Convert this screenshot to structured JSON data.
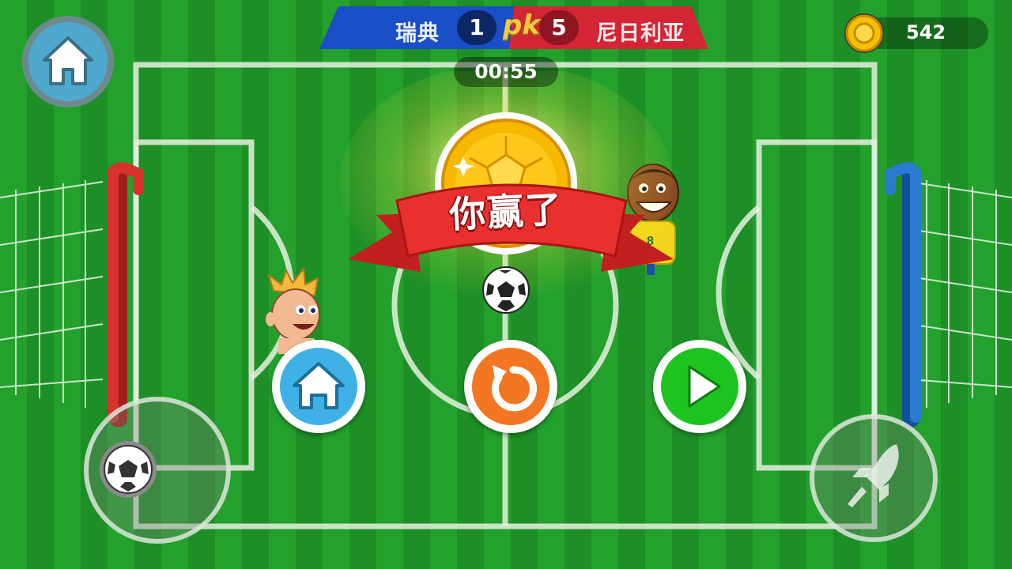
{
  "scoreboard": {
    "left_team": "瑞典",
    "left_score": "1",
    "vs": "pk",
    "right_score": "5",
    "right_team": "尼日利亚",
    "left_color": "#1a4ec6",
    "right_color": "#d32533"
  },
  "timer": "00:55",
  "coins": {
    "count": "542"
  },
  "result": {
    "banner": "你赢了"
  },
  "buttons": {
    "home_icon": "home-icon",
    "restart_icon": "restart-icon",
    "next_icon": "play-icon",
    "kick_icon": "rocket-icon",
    "joystick_icon": "soccer-ball-icon"
  },
  "colors": {
    "pitch_light": "#23a12c",
    "pitch_dark": "#1d8f26",
    "home_blue": "#3fb1e6",
    "restart_orange": "#f37722",
    "next_green": "#1dc31f",
    "left_goal": "#d8322c",
    "right_goal": "#2a7ad0"
  }
}
